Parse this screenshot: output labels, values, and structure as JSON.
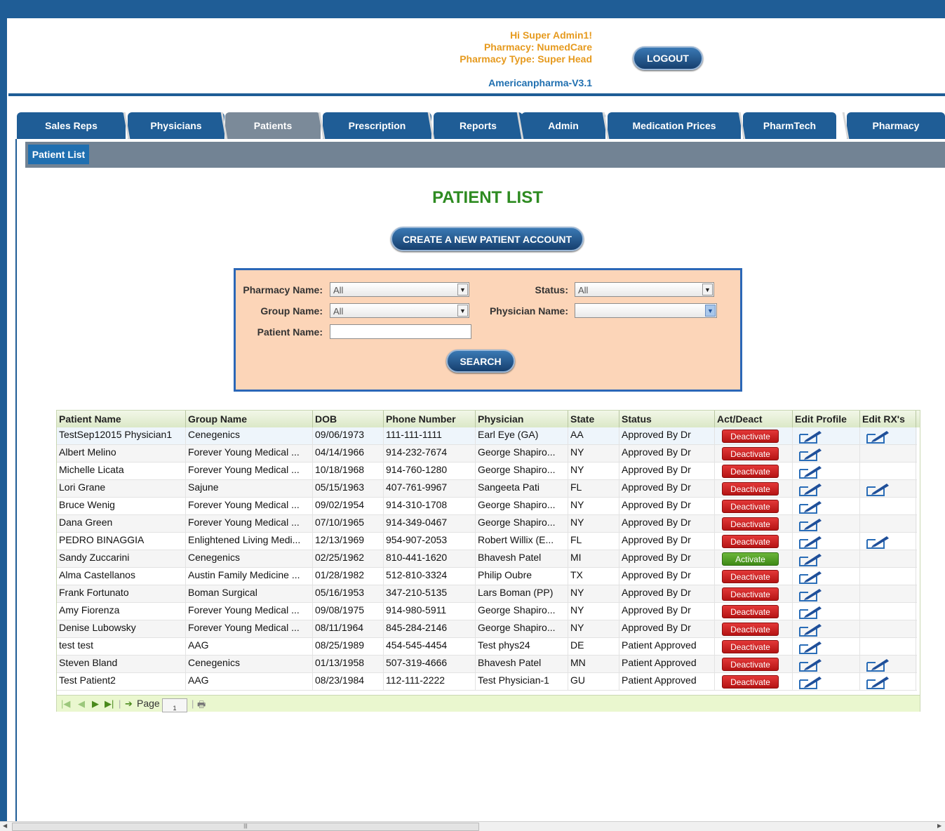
{
  "header": {
    "greeting": "Hi Super Admin1!",
    "pharmacy": "Pharmacy: NumedCare",
    "pharmacy_type": "Pharmacy Type: Super Head",
    "version": "Americanpharma-V3.1",
    "logout_label": "LOGOUT"
  },
  "tabs": [
    {
      "label": "Sales Reps"
    },
    {
      "label": "Physicians"
    },
    {
      "label": "Patients"
    },
    {
      "label": "Prescription"
    },
    {
      "label": "Reports"
    },
    {
      "label": "Admin"
    },
    {
      "label": "Medication Prices"
    },
    {
      "label": "PharmTech"
    },
    {
      "label": "Pharmacy"
    }
  ],
  "subnav": {
    "item": "Patient List"
  },
  "main": {
    "title": "PATIENT LIST",
    "create_label": "CREATE A NEW PATIENT ACCOUNT"
  },
  "search": {
    "pharmacy_label": "Pharmacy Name:",
    "pharmacy_value": "All",
    "status_label": "Status:",
    "status_value": "All",
    "group_label": "Group Name:",
    "group_value": "All",
    "physician_label": "Physician Name:",
    "physician_value": "",
    "patient_label": "Patient Name:",
    "patient_value": "",
    "button_label": "SEARCH"
  },
  "table": {
    "columns": [
      "Patient Name",
      "Group Name",
      "DOB",
      "Phone Number",
      "Physician",
      "State",
      "Status",
      "Act/Deact",
      "Edit Profile",
      "Edit RX's"
    ],
    "rows": [
      {
        "name": "TestSep12015 Physician1",
        "group": "Cenegenics",
        "dob": "09/06/1973",
        "phone": "111-111-1111",
        "physician": "Earl Eye (GA)",
        "state": "AA",
        "status": "Approved By Dr",
        "action": "Deactivate",
        "rx": true
      },
      {
        "name": "Albert Melino",
        "group": "Forever Young Medical ...",
        "dob": "04/14/1966",
        "phone": "914-232-7674",
        "physician": "George Shapiro...",
        "state": "NY",
        "status": "Approved By Dr",
        "action": "Deactivate",
        "rx": false
      },
      {
        "name": "Michelle Licata",
        "group": "Forever Young Medical ...",
        "dob": "10/18/1968",
        "phone": "914-760-1280",
        "physician": "George Shapiro...",
        "state": "NY",
        "status": "Approved By Dr",
        "action": "Deactivate",
        "rx": false
      },
      {
        "name": "Lori Grane",
        "group": "Sajune",
        "dob": "05/15/1963",
        "phone": "407-761-9967",
        "physician": "Sangeeta Pati",
        "state": "FL",
        "status": "Approved By Dr",
        "action": "Deactivate",
        "rx": true
      },
      {
        "name": "Bruce Wenig",
        "group": "Forever Young Medical ...",
        "dob": "09/02/1954",
        "phone": "914-310-1708",
        "physician": "George Shapiro...",
        "state": "NY",
        "status": "Approved By Dr",
        "action": "Deactivate",
        "rx": false
      },
      {
        "name": "Dana Green",
        "group": "Forever Young Medical ...",
        "dob": "07/10/1965",
        "phone": "914-349-0467",
        "physician": "George Shapiro...",
        "state": "NY",
        "status": "Approved By Dr",
        "action": "Deactivate",
        "rx": false
      },
      {
        "name": "PEDRO BINAGGIA",
        "group": "Enlightened Living Medi...",
        "dob": "12/13/1969",
        "phone": "954-907-2053",
        "physician": "Robert Willix (E...",
        "state": "FL",
        "status": "Approved By Dr",
        "action": "Deactivate",
        "rx": true
      },
      {
        "name": "Sandy Zuccarini",
        "group": "Cenegenics",
        "dob": "02/25/1962",
        "phone": "810-441-1620",
        "physician": "Bhavesh Patel",
        "state": "MI",
        "status": "Approved By Dr",
        "action": "Activate",
        "rx": false
      },
      {
        "name": "Alma Castellanos",
        "group": "Austin Family Medicine ...",
        "dob": "01/28/1982",
        "phone": "512-810-3324",
        "physician": "Philip Oubre",
        "state": "TX",
        "status": "Approved By Dr",
        "action": "Deactivate",
        "rx": false
      },
      {
        "name": "Frank Fortunato",
        "group": "Boman Surgical",
        "dob": "05/16/1953",
        "phone": "347-210-5135",
        "physician": "Lars Boman (PP)",
        "state": "NY",
        "status": "Approved By Dr",
        "action": "Deactivate",
        "rx": false
      },
      {
        "name": "Amy Fiorenza",
        "group": "Forever Young Medical ...",
        "dob": "09/08/1975",
        "phone": "914-980-5911",
        "physician": "George Shapiro...",
        "state": "NY",
        "status": "Approved By Dr",
        "action": "Deactivate",
        "rx": false
      },
      {
        "name": "Denise Lubowsky",
        "group": "Forever Young Medical ...",
        "dob": "08/11/1964",
        "phone": "845-284-2146",
        "physician": "George Shapiro...",
        "state": "NY",
        "status": "Approved By Dr",
        "action": "Deactivate",
        "rx": false
      },
      {
        "name": "test test",
        "group": "AAG",
        "dob": "08/25/1989",
        "phone": "454-545-4454",
        "physician": "Test phys24",
        "state": "DE",
        "status": "Patient Approved",
        "action": "Deactivate",
        "rx": false
      },
      {
        "name": "Steven Bland",
        "group": "Cenegenics",
        "dob": "01/13/1958",
        "phone": "507-319-4666",
        "physician": "Bhavesh Patel",
        "state": "MN",
        "status": "Patient Approved",
        "action": "Deactivate",
        "rx": true
      },
      {
        "name": "Test Patient2",
        "group": "AAG",
        "dob": "08/23/1984",
        "phone": "112-111-2222",
        "physician": "Test Physician-1",
        "state": "GU",
        "status": "Patient Approved",
        "action": "Deactivate",
        "rx": true
      }
    ]
  },
  "pager": {
    "page_label": "Page",
    "page_value": "1"
  },
  "icons": {
    "first": "first-page-icon",
    "prev": "prev-page-icon",
    "next": "next-page-icon",
    "last": "last-page-icon",
    "refresh": "refresh-icon",
    "print": "print-icon",
    "edit": "edit-pencil-icon"
  },
  "colors": {
    "brand": "#1f5d96",
    "title": "#2e8b21",
    "deactivate": "#c81e1e",
    "activate": "#4f9a22",
    "header_text": "#e69a1e"
  }
}
